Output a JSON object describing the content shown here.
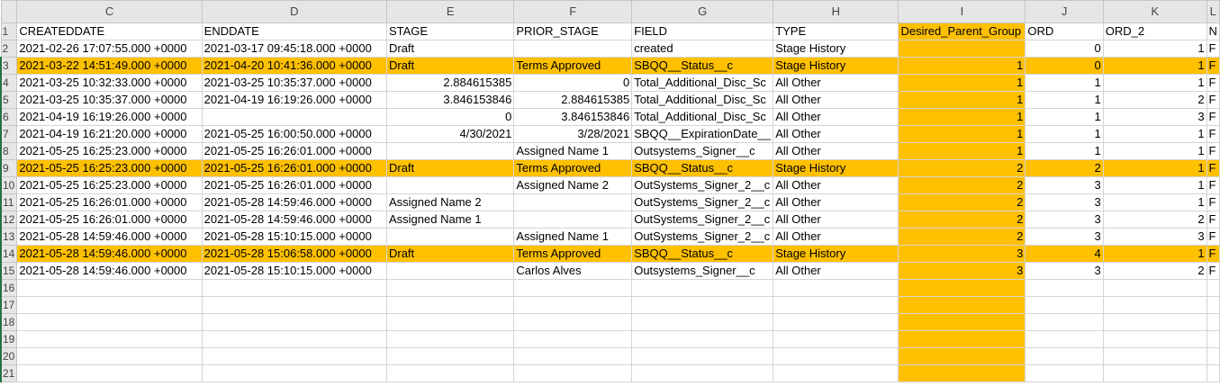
{
  "columns": [
    "C",
    "D",
    "E",
    "F",
    "G",
    "H",
    "I",
    "J",
    "K",
    "L"
  ],
  "row_numbers": [
    "1",
    "2",
    "3",
    "4",
    "5",
    "6",
    "7",
    "8",
    "9",
    "10",
    "11",
    "12",
    "13",
    "14",
    "15",
    "16",
    "17",
    "18",
    "19",
    "20",
    "21"
  ],
  "headers": [
    "CREATEDDATE",
    "ENDDATE",
    "STAGE",
    "PRIOR_STAGE",
    "FIELD",
    "TYPE",
    "Desired_Parent_Group",
    "ORD",
    "ORD_2",
    "N"
  ],
  "rows": [
    {
      "hl": false,
      "cells": [
        "2021-02-26 17:07:55.000 +0000",
        "2021-03-17 09:45:18.000 +0000",
        "Draft",
        "",
        "created",
        "Stage History",
        "",
        "0",
        "1",
        "F"
      ]
    },
    {
      "hl": true,
      "cells": [
        "2021-03-22 14:51:49.000 +0000",
        "2021-04-20 10:41:36.000 +0000",
        "Draft",
        "Terms Approved",
        "SBQQ__Status__c",
        "Stage History",
        "1",
        "0",
        "1",
        "F"
      ]
    },
    {
      "hl": false,
      "cells": [
        "2021-03-25 10:32:33.000 +0000",
        "2021-03-25 10:35:37.000 +0000",
        "2.884615385",
        "0",
        "Total_Additional_Disc_Sc",
        "All Other",
        "1",
        "1",
        "1",
        "F"
      ]
    },
    {
      "hl": false,
      "cells": [
        "2021-03-25 10:35:37.000 +0000",
        "2021-04-19 16:19:26.000 +0000",
        "3.846153846",
        "2.884615385",
        "Total_Additional_Disc_Sc",
        "All Other",
        "1",
        "1",
        "2",
        "F"
      ]
    },
    {
      "hl": false,
      "cells": [
        "2021-04-19 16:19:26.000 +0000",
        "",
        "0",
        "3.846153846",
        "Total_Additional_Disc_Sc",
        "All Other",
        "1",
        "1",
        "3",
        "F"
      ]
    },
    {
      "hl": false,
      "cells": [
        "2021-04-19 16:21:20.000 +0000",
        "2021-05-25 16:00:50.000 +0000",
        "4/30/2021",
        "3/28/2021",
        "SBQQ__ExpirationDate__",
        "All Other",
        "1",
        "1",
        "1",
        "F"
      ]
    },
    {
      "hl": false,
      "cells": [
        "2021-05-25 16:25:23.000 +0000",
        "2021-05-25 16:26:01.000 +0000",
        "",
        "Assigned Name 1",
        "Outsystems_Signer__c",
        "All Other",
        "1",
        "1",
        "1",
        "F"
      ]
    },
    {
      "hl": true,
      "cells": [
        "2021-05-25 16:25:23.000 +0000",
        "2021-05-25 16:26:01.000 +0000",
        "Draft",
        "Terms Approved",
        "SBQQ__Status__c",
        "Stage History",
        "2",
        "2",
        "1",
        "F"
      ]
    },
    {
      "hl": false,
      "cells": [
        "2021-05-25 16:25:23.000 +0000",
        "2021-05-25 16:26:01.000 +0000",
        "",
        "Assigned Name 2",
        "OutSystems_Signer_2__c",
        "All Other",
        "2",
        "3",
        "1",
        "F"
      ]
    },
    {
      "hl": false,
      "cells": [
        "2021-05-25 16:26:01.000 +0000",
        "2021-05-28 14:59:46.000 +0000",
        "Assigned Name 2",
        "",
        "OutSystems_Signer_2__c",
        "All Other",
        "2",
        "3",
        "1",
        "F"
      ]
    },
    {
      "hl": false,
      "cells": [
        "2021-05-25 16:26:01.000 +0000",
        "2021-05-28 14:59:46.000 +0000",
        "Assigned Name 1",
        "",
        "OutSystems_Signer_2__c",
        "All Other",
        "2",
        "3",
        "2",
        "F"
      ]
    },
    {
      "hl": false,
      "cells": [
        "2021-05-28 14:59:46.000 +0000",
        "2021-05-28 15:10:15.000 +0000",
        "",
        "Assigned Name 1",
        "OutSystems_Signer_2__c",
        "All Other",
        "2",
        "3",
        "3",
        "F"
      ]
    },
    {
      "hl": true,
      "cells": [
        "2021-05-28 14:59:46.000 +0000",
        "2021-05-28 15:06:58.000 +0000",
        "Draft",
        "Terms Approved",
        "SBQQ__Status__c",
        "Stage History",
        "3",
        "4",
        "1",
        "F"
      ]
    },
    {
      "hl": false,
      "cells": [
        "2021-05-28 14:59:46.000 +0000",
        "2021-05-28 15:10:15.000 +0000",
        "",
        "Carlos Alves",
        "Outsystems_Signer__c",
        "All Other",
        "3",
        "3",
        "2",
        "F"
      ]
    }
  ],
  "empty_rows": 6,
  "highlight_color": "#ffc000"
}
